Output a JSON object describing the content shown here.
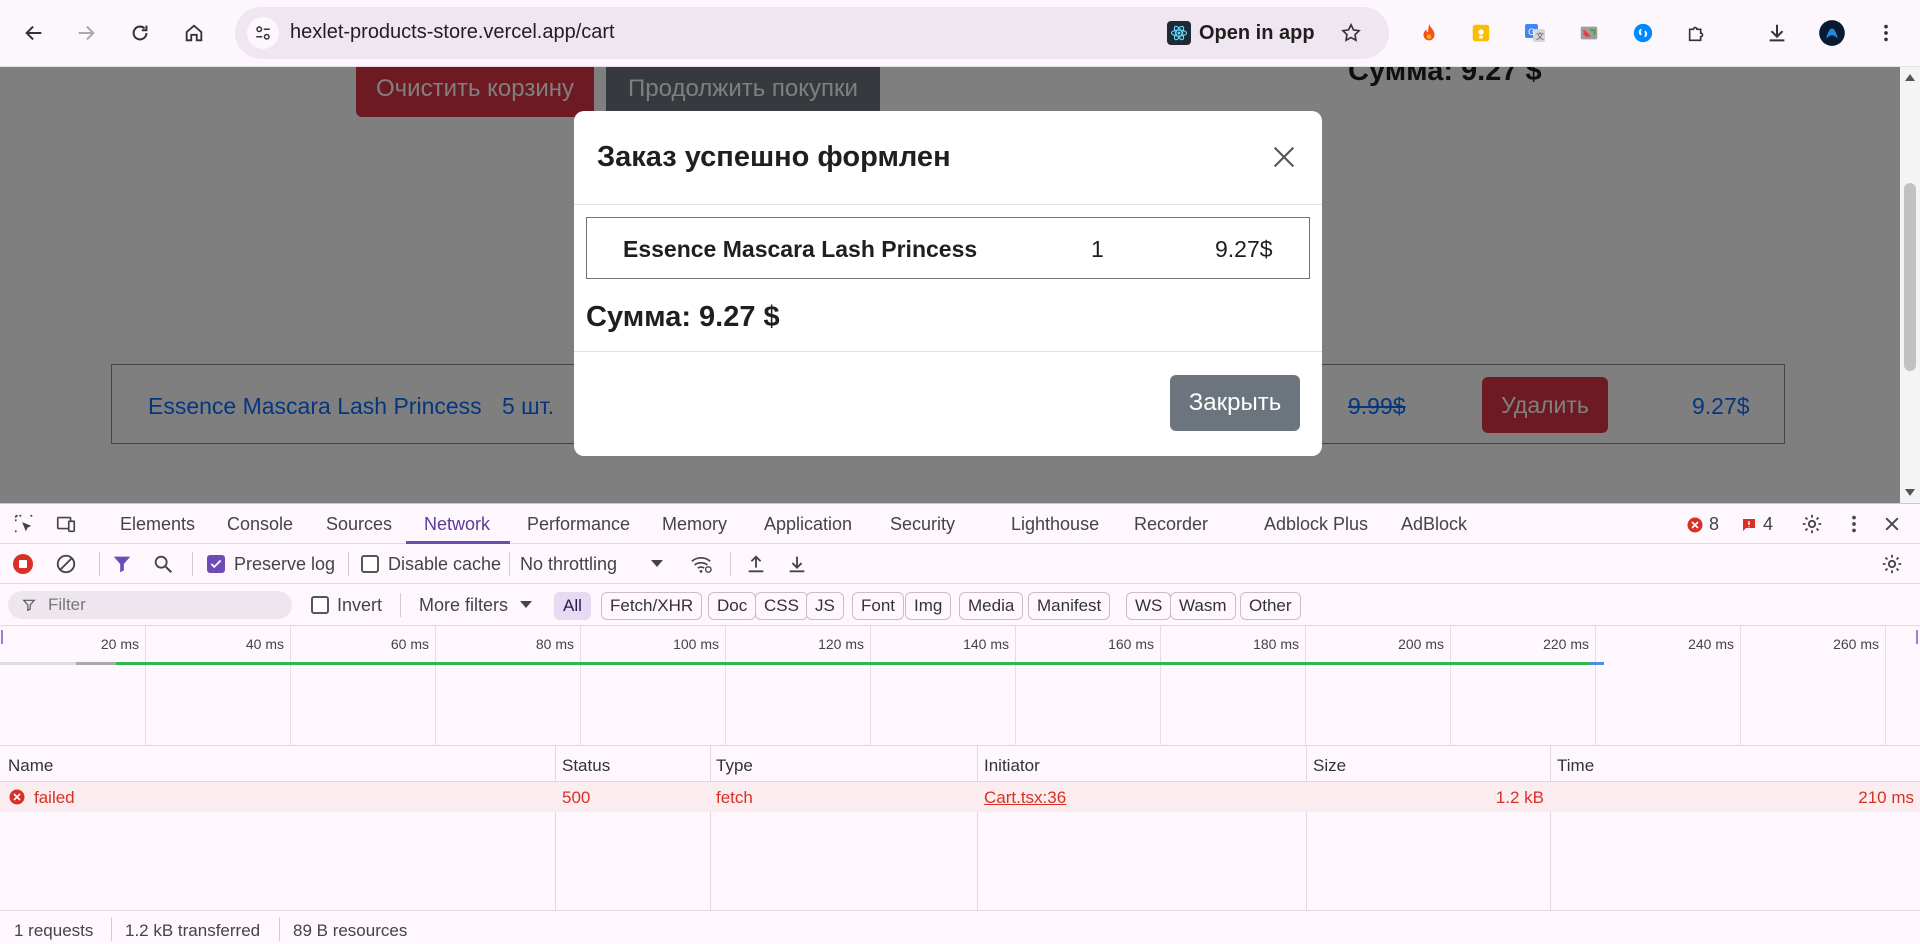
{
  "browser": {
    "url": "hexlet-products-store.vercel.app/cart",
    "open_in_app": "Open in app"
  },
  "page": {
    "clear_cart_label": "Очистить корзину",
    "continue_shopping_label": "Продолжить покупки",
    "total": "Сумма: 9.27 $",
    "cart_item": {
      "name": "Essence Mascara Lash Princess",
      "qty": "5 шт.",
      "old_price": "9.99$",
      "delete_label": "Удалить",
      "price": "9.27$"
    }
  },
  "modal": {
    "title": "Заказ успешно формлен",
    "item": {
      "name": "Essence Mascara Lash Princess",
      "qty": "1",
      "price": "9.27$"
    },
    "total": "Сумма: 9.27 $",
    "close_label": "Закрыть"
  },
  "devtools": {
    "tabs": [
      "Elements",
      "Console",
      "Sources",
      "Network",
      "Performance",
      "Memory",
      "Application",
      "Security",
      "Lighthouse",
      "Recorder",
      "Adblock Plus",
      "AdBlock"
    ],
    "active_tab": "Network",
    "error_count": "8",
    "issue_count": "4",
    "preserve_log_label": "Preserve log",
    "preserve_log_checked": true,
    "disable_cache_label": "Disable cache",
    "throttling": "No throttling",
    "filter_placeholder": "Filter",
    "invert_label": "Invert",
    "more_filters_label": "More filters",
    "type_filters": [
      "All",
      "Fetch/XHR",
      "Doc",
      "CSS",
      "JS",
      "Font",
      "Img",
      "Media",
      "Manifest",
      "WS",
      "Wasm",
      "Other"
    ],
    "timeline_labels": [
      "20 ms",
      "40 ms",
      "60 ms",
      "80 ms",
      "100 ms",
      "120 ms",
      "140 ms",
      "160 ms",
      "180 ms",
      "200 ms",
      "220 ms",
      "240 ms",
      "260 ms"
    ],
    "table": {
      "columns": [
        "Name",
        "Status",
        "Type",
        "Initiator",
        "Size",
        "Time"
      ],
      "rows": [
        {
          "name": "failed",
          "status": "500",
          "type": "fetch",
          "initiator": "Cart.tsx:36",
          "size": "1.2 kB",
          "time": "210 ms"
        }
      ]
    },
    "summary": {
      "requests": "1 requests",
      "transferred": "1.2 kB transferred",
      "resources": "89 B resources"
    }
  },
  "colors": {
    "danger": "#dc3545",
    "secondary": "#6c757d",
    "link": "#0d6efd",
    "devtools_accent": "#6e4cb5",
    "error": "#d93025"
  }
}
